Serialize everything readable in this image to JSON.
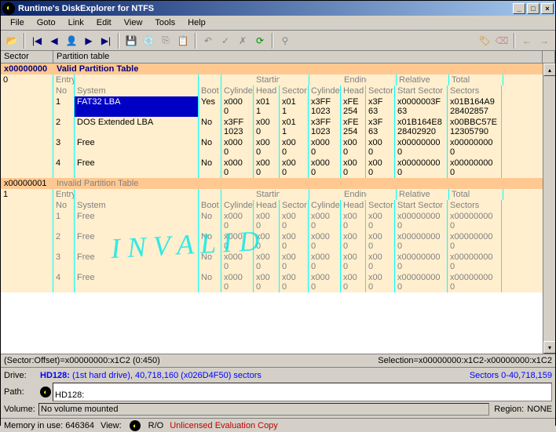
{
  "title": "Runtime's DiskExplorer for NTFS",
  "menu": [
    "File",
    "Goto",
    "Link",
    "Edit",
    "View",
    "Tools",
    "Help"
  ],
  "header": {
    "c1": "Sector",
    "c2": "Partition table"
  },
  "sector0": {
    "addr": "x00000000",
    "label": "Valid Partition Table",
    "idx": "0",
    "cols1": {
      "entry": "Entry",
      "system": "",
      "boot": "",
      "starting": "Starting",
      "ending": "Ending",
      "rel": "Relative",
      "tot": "Total"
    },
    "cols2": {
      "entry": "No",
      "system": "System",
      "boot": "Boot",
      "cyl": "Cylinder",
      "head": "Head",
      "sect": "Sector",
      "cyl2": "Cylinder",
      "head2": "Head",
      "sect2": "Sector",
      "rel": "Start Sector",
      "tot": "Sectors"
    },
    "rows": [
      {
        "no": "1",
        "sys": "FAT32 LBA",
        "boot": "Yes",
        "cyl": "x000\n0",
        "head": "x01\n1",
        "sect": "x01\n1",
        "cyl2": "x3FF\n1023",
        "head2": "xFE\n254",
        "sect2": "x3F\n63",
        "rel": "x0000003F\n63",
        "tot": "x01B164A9\n28402857",
        "sel": true
      },
      {
        "no": "2",
        "sys": "DOS Extended LBA",
        "boot": "No",
        "cyl": "x3FF\n1023",
        "head": "x00\n0",
        "sect": "x01\n1",
        "cyl2": "x3FF\n1023",
        "head2": "xFE\n254",
        "sect2": "x3F\n63",
        "rel": "x01B164E8\n28402920",
        "tot": "x00BBC57E\n12305790"
      },
      {
        "no": "3",
        "sys": "Free",
        "boot": "No",
        "cyl": "x000\n0",
        "head": "x00\n0",
        "sect": "x00\n0",
        "cyl2": "x000\n0",
        "head2": "x00\n0",
        "sect2": "x00\n0",
        "rel": "x00000000\n0",
        "tot": "x00000000\n0"
      },
      {
        "no": "4",
        "sys": "Free",
        "boot": "No",
        "cyl": "x000\n0",
        "head": "x00\n0",
        "sect": "x00\n0",
        "cyl2": "x000\n0",
        "head2": "x00\n0",
        "sect2": "x00\n0",
        "rel": "x00000000\n0",
        "tot": "x00000000\n0"
      }
    ]
  },
  "sector1": {
    "addr": "x00000001",
    "label": "Invalid Partition Table",
    "idx": "1",
    "rows": [
      {
        "no": "1",
        "sys": "Free",
        "boot": "No",
        "cyl": "x000\n0",
        "head": "x00\n0",
        "sect": "x00\n0",
        "cyl2": "x000\n0",
        "head2": "x00\n0",
        "sect2": "x00\n0",
        "rel": "x00000000\n0",
        "tot": "x00000000\n0"
      },
      {
        "no": "2",
        "sys": "Free",
        "boot": "No",
        "cyl": "x000\n0",
        "head": "x00\n0",
        "sect": "x00\n0",
        "cyl2": "x000\n0",
        "head2": "x00\n0",
        "sect2": "x00\n0",
        "rel": "x00000000\n0",
        "tot": "x00000000\n0"
      },
      {
        "no": "3",
        "sys": "Free",
        "boot": "No",
        "cyl": "x000\n0",
        "head": "x00\n0",
        "sect": "x00\n0",
        "cyl2": "x000\n0",
        "head2": "x00\n0",
        "sect2": "x00\n0",
        "rel": "x00000000\n0",
        "tot": "x00000000\n0"
      },
      {
        "no": "4",
        "sys": "Free",
        "boot": "No",
        "cyl": "x000\n0",
        "head": "x00\n0",
        "sect": "x00\n0",
        "cyl2": "x000\n0",
        "head2": "x00\n0",
        "sect2": "x00\n0",
        "rel": "x00000000\n0",
        "tot": "x00000000\n0"
      }
    ]
  },
  "watermark": "I N V A L I D",
  "statusline": {
    "left": "(Sector:Offset)=x00000000:x1C2 (0:450)",
    "right": "Selection=x00000000:x1C2-x00000000:x1C2"
  },
  "drive": {
    "lbl": "Drive:",
    "name": "HD128:",
    "rest": " (1st hard drive), 40,718,160 (x026D4F50) sectors",
    "right": "Sectors 0-40,718,159"
  },
  "path": {
    "lbl": "Path:",
    "val": "HD128:"
  },
  "volume": {
    "lbl": "Volume:",
    "val": "No volume mounted",
    "region": "Region:",
    "regval": "NONE"
  },
  "status": {
    "mem": "Memory in use: 646364",
    "view": "View:",
    "ro": "R/O",
    "lic": "Unlicensed Evaluation Copy"
  }
}
